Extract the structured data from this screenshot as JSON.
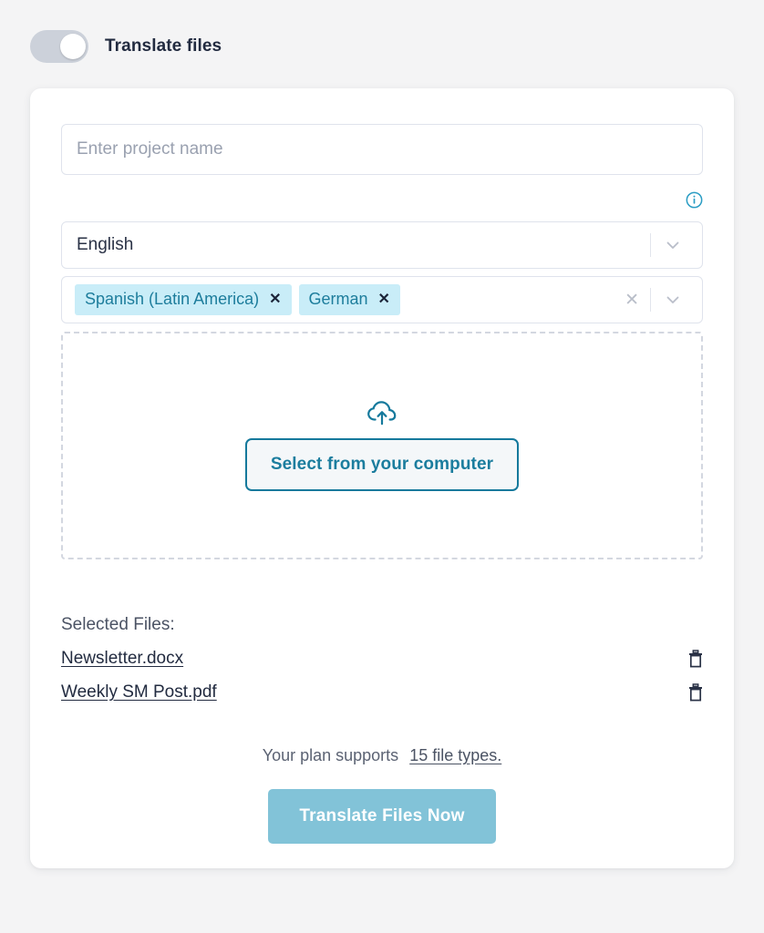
{
  "header": {
    "toggle_state": "off",
    "title": "Translate files"
  },
  "form": {
    "project_name": {
      "value": "",
      "placeholder": "Enter project name"
    },
    "info_icon": "info-circle-icon",
    "source_language": {
      "selected": "English",
      "chevron": "chevron-down-icon"
    },
    "target_languages": {
      "chips": [
        {
          "label": "Spanish (Latin America)",
          "remove": "✕"
        },
        {
          "label": "German",
          "remove": "✕"
        }
      ],
      "clear_all": "✕",
      "chevron": "chevron-down-icon"
    },
    "dropzone": {
      "icon": "cloud-upload-icon",
      "button_label": "Select from your computer"
    }
  },
  "selected_files": {
    "title": "Selected Files:",
    "items": [
      {
        "name": "Newsletter.docx",
        "delete_icon": "trash-icon"
      },
      {
        "name": "Weekly SM Post.pdf",
        "delete_icon": "trash-icon"
      }
    ]
  },
  "footer": {
    "plan_text": "Your plan supports",
    "plan_link": "15 file types.",
    "cta_label": "Translate Files Now"
  },
  "colors": {
    "page_background": "#f4f4f5",
    "card_background": "#ffffff",
    "accent_teal": "#15799c",
    "chip_background": "#c9edf8",
    "chip_text": "#1d7d9c",
    "cta_background": "#82c3d8",
    "heading_text": "#222b40",
    "toggle_track": "#ccd1da"
  }
}
